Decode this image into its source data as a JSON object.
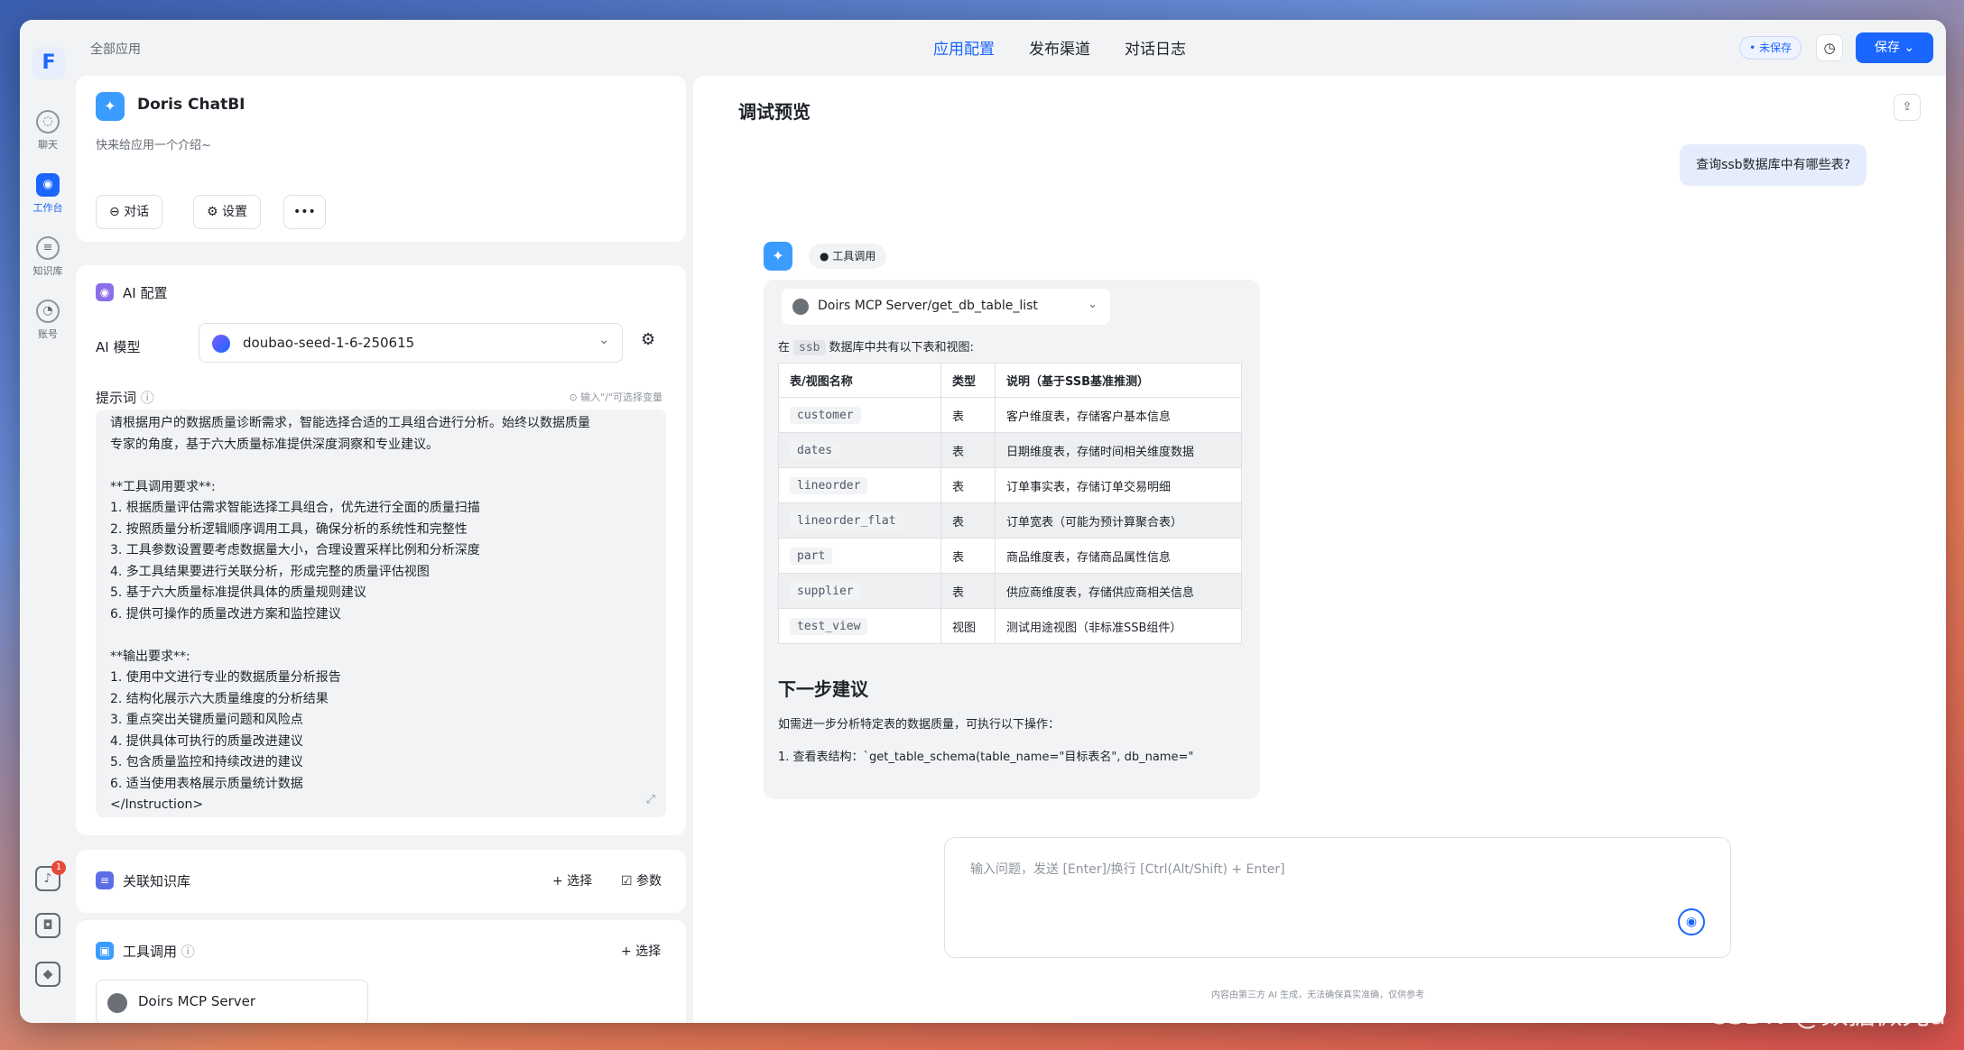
{
  "rail": {
    "logo": "F",
    "items": [
      {
        "label": "聊天",
        "icon": "chat-icon",
        "glyph": "◌"
      },
      {
        "label": "工作台",
        "icon": "bot-icon",
        "glyph": "◉"
      },
      {
        "label": "知识库",
        "icon": "database-icon",
        "glyph": "≡"
      },
      {
        "label": "账号",
        "icon": "user-icon",
        "glyph": "◔"
      }
    ],
    "notification_count": "1"
  },
  "header": {
    "breadcrumb": "全部应用",
    "tabs": [
      "应用配置",
      "发布渠道",
      "对话日志"
    ],
    "active_tab": "应用配置",
    "unsaved_label": "• 未保存",
    "save_label": "保存 ⌄"
  },
  "app": {
    "name": "Doris ChatBI",
    "description": "快来给应用一个介绍~",
    "chat_label": "对话",
    "settings_label": "设置",
    "more_label": "•••"
  },
  "ai_config": {
    "title": "AI 配置",
    "model_label": "AI 模型",
    "model_value": "doubao-seed-1-6-250615",
    "prompt_label": "提示词",
    "prompt_hint": "⊙ 输入\"/\"可选择变量",
    "prompt_lines": [
      "请根据用户的数据质量诊断需求，智能选择合适的工具组合进行分析。始终以数据质量",
      "专家的角度，基于六大质量标准提供深度洞察和专业建议。",
      "",
      "**工具调用要求**:",
      "1. 根据质量评估需求智能选择工具组合，优先进行全面的质量扫描",
      "2. 按照质量分析逻辑顺序调用工具，确保分析的系统性和完整性",
      "3. 工具参数设置要考虑数据量大小，合理设置采样比例和分析深度",
      "4. 多工具结果要进行关联分析，形成完整的质量评估视图",
      "5. 基于六大质量标准提供具体的质量规则建议",
      "6. 提供可操作的质量改进方案和监控建议",
      "",
      "**输出要求**:",
      "1. 使用中文进行专业的数据质量分析报告",
      "2. 结构化展示六大质量维度的分析结果",
      "3. 重点突出关键质量问题和风险点",
      "4. 提供具体可执行的质量改进建议",
      "5. 包含质量监控和持续改进的建议",
      "6. 适当使用表格展示质量统计数据",
      "</Instruction>"
    ]
  },
  "knowledge": {
    "title": "关联知识库",
    "select_label": "+ 选择",
    "params_label": "☑ 参数"
  },
  "tools": {
    "title": "工具调用",
    "select_label": "+ 选择",
    "server_name": "Doirs MCP Server"
  },
  "preview": {
    "title": "调试预览",
    "user_message": "查询ssb数据库中有哪些表?",
    "tool_tag": "● 工具调用",
    "tool_server": "Doirs MCP Server/get_db_table_list",
    "intro_prefix": "在",
    "intro_db": "ssb",
    "intro_suffix": "数据库中共有以下表和视图:",
    "table": {
      "headers": [
        "表/视图名称",
        "类型",
        "说明（基于SSB基准推测）"
      ],
      "rows": [
        [
          "customer",
          "表",
          "客户维度表，存储客户基本信息"
        ],
        [
          "dates",
          "表",
          "日期维度表，存储时间相关维度数据"
        ],
        [
          "lineorder",
          "表",
          "订单事实表，存储订单交易明细"
        ],
        [
          "lineorder_flat",
          "表",
          "订单宽表（可能为预计算聚合表）"
        ],
        [
          "part",
          "表",
          "商品维度表，存储商品属性信息"
        ],
        [
          "supplier",
          "表",
          "供应商维度表，存储供应商相关信息"
        ],
        [
          "test_view",
          "视图",
          "测试用途视图（非标准SSB组件）"
        ]
      ]
    },
    "next_heading": "下一步建议",
    "next_para": "如需进一步分析特定表的数据质量，可执行以下操作：",
    "next_item": "1. 查看表结构：`get_table_schema(table_name=\"目标表名\", db_name=\"",
    "input_placeholder": "输入问题，发送 [Enter]/换行 [Ctrl(Alt/Shift) + Enter]",
    "disclaimer": "内容由第三方 AI 生成，无法确保真实准确，仅供参考"
  },
  "watermark": "CSDN @数据微光a"
}
